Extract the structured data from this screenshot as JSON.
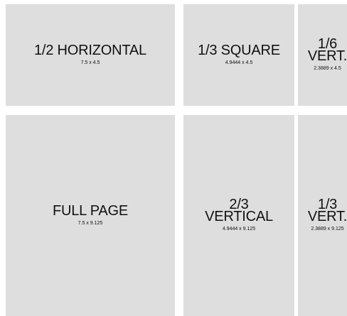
{
  "colors": {
    "panel_background": "#dedede",
    "text": "#111111",
    "page_background": "#ffffff"
  },
  "panels": {
    "half_horizontal": {
      "title": "1/2 HORIZONTAL",
      "dims": "7.5 x 4.5"
    },
    "third_square": {
      "title": "1/3 SQUARE",
      "dims": "4.9444 x 4.5"
    },
    "sixth_vert": {
      "title_line1": "1/6",
      "title_line2": "VERT.",
      "dims": "2.3889 x 4.5"
    },
    "full_page": {
      "title": "FULL PAGE",
      "dims": "7.5 x 9.125"
    },
    "two_thirds_vert": {
      "title_line1": "2/3",
      "title_line2": "VERTICAL",
      "dims": "4.9444 x 9.125"
    },
    "third_vert": {
      "title_line1": "1/3",
      "title_line2": "VERT.",
      "dims": "2.3889 x 9.125"
    }
  }
}
